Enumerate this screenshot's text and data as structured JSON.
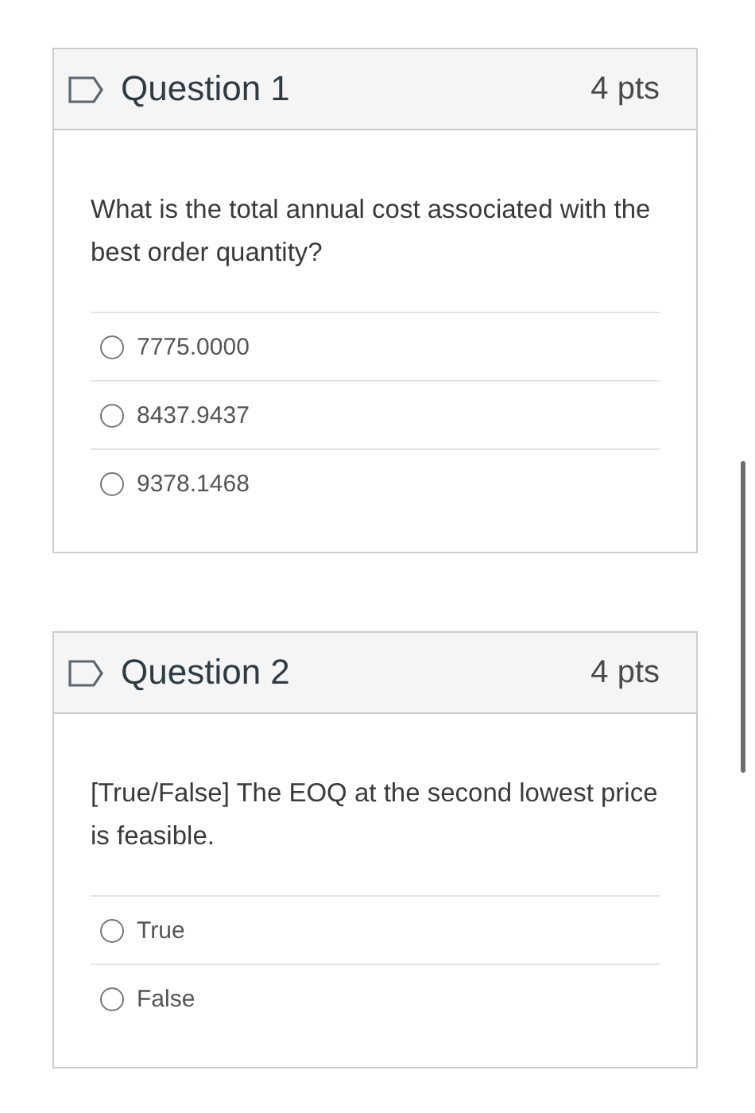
{
  "questions": [
    {
      "title": "Question 1",
      "points": "4 pts",
      "text": "What is the total annual cost associated with the best order quantity?",
      "answers": [
        {
          "label": "7775.0000",
          "selected": false
        },
        {
          "label": "8437.9437",
          "selected": false
        },
        {
          "label": "9378.1468",
          "selected": false
        }
      ]
    },
    {
      "title": "Question 2",
      "points": "4 pts",
      "text": "[True/False] The EOQ at the second lowest price is feasible.",
      "answers": [
        {
          "label": "True",
          "selected": false
        },
        {
          "label": "False",
          "selected": false
        }
      ]
    }
  ]
}
